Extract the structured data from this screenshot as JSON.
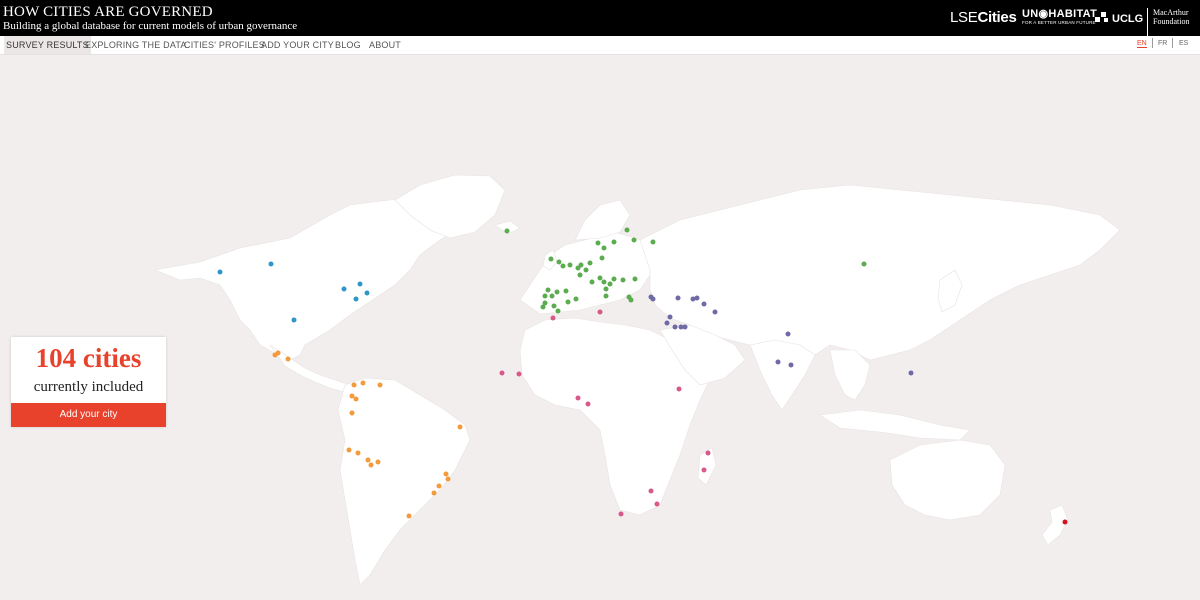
{
  "header": {
    "title": "HOW CITIES ARE GOVERNED",
    "subtitle": "Building a global database for current models of urban governance",
    "logos": {
      "lse_light": "LSE",
      "lse_bold": "Cities",
      "unhabitat_main": "UN◉HABITAT",
      "unhabitat_tagline": "FOR A BETTER URBAN FUTURE",
      "uclg": "UCLG",
      "macarthur_line1": "MacArthur",
      "macarthur_line2": "Foundation"
    }
  },
  "nav": {
    "items": [
      "SURVEY RESULTS",
      "EXPLORING THE DATA",
      "CITIES' PROFILES",
      "ADD YOUR CITY",
      "BLOG",
      "ABOUT"
    ],
    "active_index": 0,
    "languages": [
      "EN",
      "FR",
      "ES"
    ],
    "active_language": "EN"
  },
  "stats": {
    "count": "104 cities",
    "label": "currently included",
    "button": "Add your city"
  },
  "colors": {
    "accent": "#e8412c",
    "background": "#f3eeee",
    "land": "#ffffff",
    "region_north_america": "#2e96c8",
    "region_latin_america": "#f39a3c",
    "region_europe": "#5bab4f",
    "region_africa": "#d9588a",
    "region_asia": "#6e6aa6",
    "region_oceania": "#d4121b"
  }
}
